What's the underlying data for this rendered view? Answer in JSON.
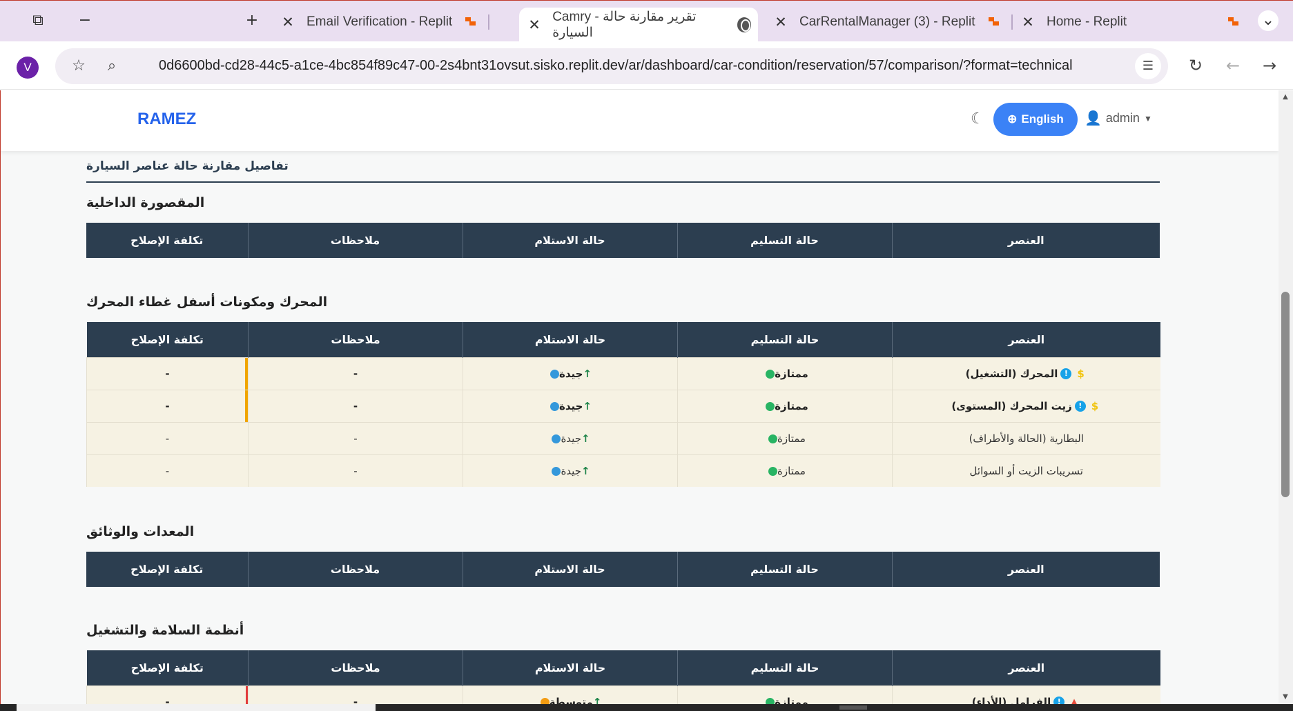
{
  "browser": {
    "tabs": [
      {
        "title": "Email Verification - Replit",
        "active": false
      },
      {
        "title": "Camry - تقرير مقارنة حالة السيارة",
        "active": true
      },
      {
        "title": "CarRentalManager (3) - Replit",
        "active": false
      },
      {
        "title": "Home - Replit",
        "active": false
      }
    ],
    "profile_initial": "V",
    "url": "0d6600bd-cd28-44c5-a1ce-4bc854f89c47-00-2s4bnt31ovsut.sisko.replit.dev/ar/dashboard/car-condition/reservation/57/comparison/?format=technical"
  },
  "app": {
    "brand": "RAMEZ",
    "language_button": "English",
    "user": "admin"
  },
  "section_title": "تفاصيل مقارنة حالة عناصر السيارة",
  "table_headers": {
    "item": "العنصر",
    "delivery": "حالة التسليم",
    "receipt": "حالة الاستلام",
    "notes": "ملاحظات",
    "cost": "تكلفة الإصلاح"
  },
  "categories": [
    {
      "title": "المقصورة الداخلية",
      "rows": []
    },
    {
      "title": "المحرك ومكونات أسفل غطاء المحرك",
      "rows": [
        {
          "item": "المحرك (التشغيل)",
          "delivery": "ممتازة",
          "receipt": "جيدة",
          "notes": "-",
          "cost": "-"
        },
        {
          "item": "زيت المحرك (المستوى)",
          "delivery": "ممتازة",
          "receipt": "جيدة",
          "notes": "-",
          "cost": "-"
        },
        {
          "item": "البطارية (الحالة والأطراف)",
          "delivery": "ممتازة",
          "receipt": "جيدة",
          "notes": "-",
          "cost": "-"
        },
        {
          "item": "تسريبات الزيت أو السوائل",
          "delivery": "ممتازة",
          "receipt": "جيدة",
          "notes": "-",
          "cost": "-"
        }
      ]
    },
    {
      "title": "المعدات والوثائق",
      "rows": []
    },
    {
      "title": "أنظمة السلامة والتشغيل",
      "rows": [
        {
          "item": "الفرامل (الأداء)",
          "delivery": "ممتازة",
          "receipt": "متوسطة",
          "notes": "-",
          "cost": "-"
        }
      ]
    }
  ],
  "colors": {
    "header_bg": "#2c3e50",
    "row_bg": "#f6f2e3",
    "brand": "#2563eb",
    "good": "#3498db",
    "excellent": "#28b463",
    "average": "#f39c12"
  }
}
